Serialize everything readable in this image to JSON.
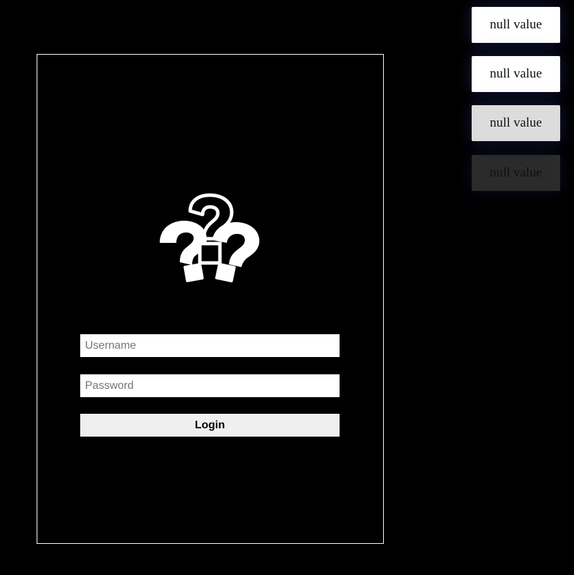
{
  "login": {
    "logo_icon": "question-marks-icon",
    "username_placeholder": "Username",
    "password_placeholder": "Password",
    "login_label": "Login"
  },
  "side_buttons": [
    {
      "label": "null value",
      "state": "normal"
    },
    {
      "label": "null value",
      "state": "normal"
    },
    {
      "label": "null value",
      "state": "hover"
    },
    {
      "label": "null value",
      "state": "disabled"
    }
  ],
  "colors": {
    "background": "#000000",
    "panel_border": "#ffffff",
    "input_bg": "#ffffff",
    "button_bg": "#efefef",
    "side_hover_bg": "#dcdcdc",
    "side_disabled_bg": "#2b2b2b"
  }
}
